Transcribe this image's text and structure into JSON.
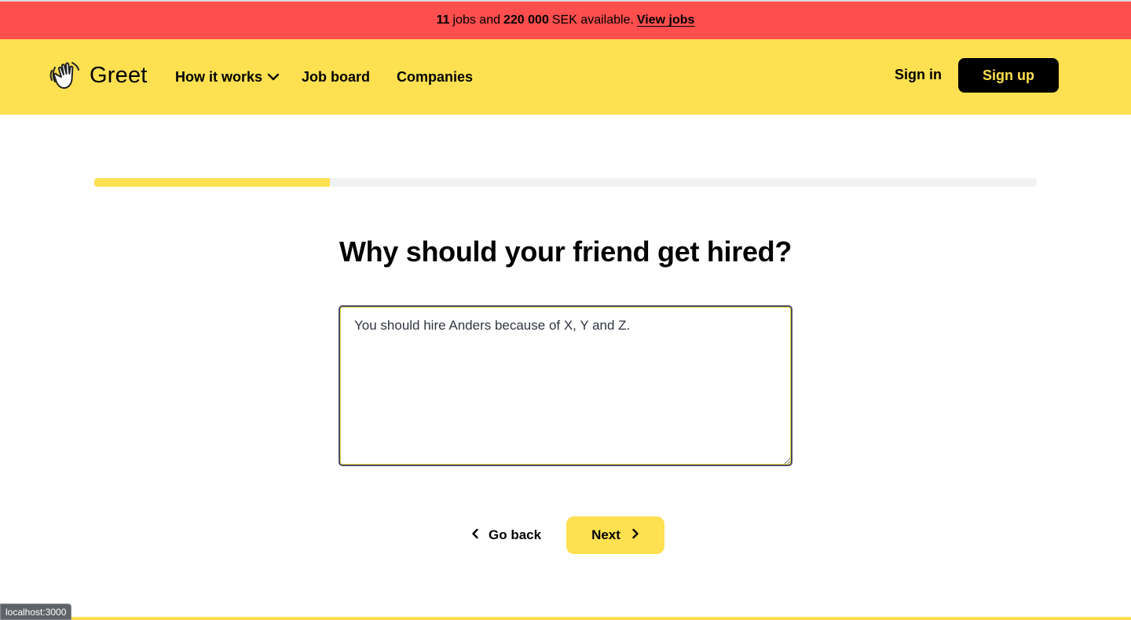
{
  "colors": {
    "banner_bg": "#ff4e4e",
    "header_bg": "#fee050",
    "accent": "#fee050",
    "signup_bg": "#000000",
    "signup_text": "#fee050"
  },
  "banner": {
    "jobs_count": "11",
    "jobs_text": "jobs and",
    "amount": "220 000",
    "amount_text": "SEK available.",
    "link_label": "View jobs"
  },
  "header": {
    "logo_text": "Greet",
    "logo_icon": "waving-hand-icon",
    "nav": {
      "how_it_works": "How it works",
      "job_board": "Job board",
      "companies": "Companies"
    },
    "sign_in": "Sign in",
    "sign_up": "Sign up"
  },
  "progress": {
    "fraction": 0.25
  },
  "question": {
    "title": "Why should your friend get hired?"
  },
  "answer": {
    "value": "You should hire Anders because of X, Y and Z."
  },
  "buttons": {
    "go_back": "Go back",
    "next": "Next"
  },
  "status_bar": {
    "url": "localhost:3000"
  }
}
